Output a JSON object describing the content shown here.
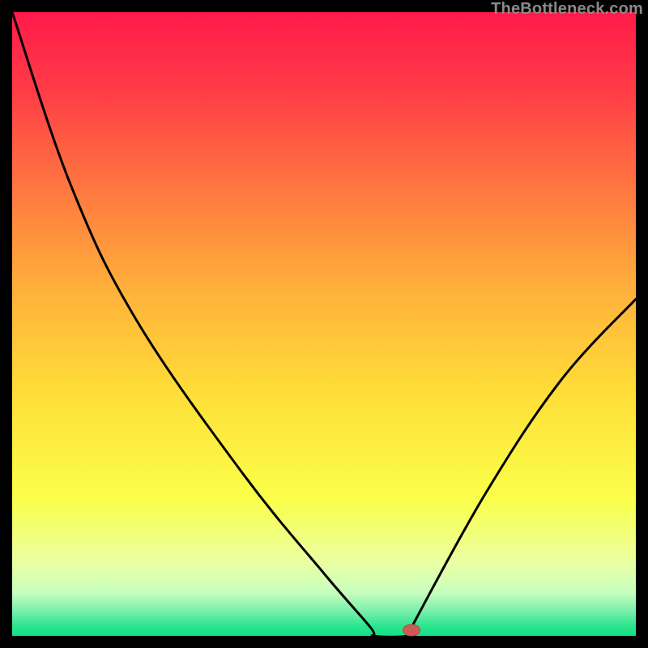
{
  "watermark": "TheBottleneck.com",
  "chart_data": {
    "type": "line",
    "title": "",
    "xlabel": "",
    "ylabel": "",
    "xlim": [
      0,
      100
    ],
    "ylim": [
      0,
      100
    ],
    "series": [
      {
        "name": "bottleneck-curve",
        "points": [
          {
            "x": 0.0,
            "y": 100.0
          },
          {
            "x": 9.5,
            "y": 72.0
          },
          {
            "x": 20.0,
            "y": 50.5
          },
          {
            "x": 37.0,
            "y": 26.0
          },
          {
            "x": 50.0,
            "y": 10.0
          },
          {
            "x": 57.5,
            "y": 1.3
          },
          {
            "x": 58.0,
            "y": 0.0
          },
          {
            "x": 63.5,
            "y": 0.0
          },
          {
            "x": 64.0,
            "y": 1.3
          },
          {
            "x": 76.0,
            "y": 23.0
          },
          {
            "x": 88.0,
            "y": 41.0
          },
          {
            "x": 100.0,
            "y": 54.0
          }
        ]
      }
    ],
    "marker": {
      "x": 64.0,
      "y": 0.0,
      "color": "#cc5b55"
    },
    "gradient_stops": [
      {
        "pct": 0,
        "color": "#ff1a4a"
      },
      {
        "pct": 12,
        "color": "#ff3a46"
      },
      {
        "pct": 28,
        "color": "#ff7640"
      },
      {
        "pct": 45,
        "color": "#ffb23b"
      },
      {
        "pct": 62,
        "color": "#ffe038"
      },
      {
        "pct": 78,
        "color": "#faff4a"
      },
      {
        "pct": 88,
        "color": "#ebffa0"
      },
      {
        "pct": 93,
        "color": "#c8ffbf"
      },
      {
        "pct": 96,
        "color": "#7aefab"
      },
      {
        "pct": 98.5,
        "color": "#29e58e"
      },
      {
        "pct": 100,
        "color": "#14e086"
      }
    ]
  }
}
